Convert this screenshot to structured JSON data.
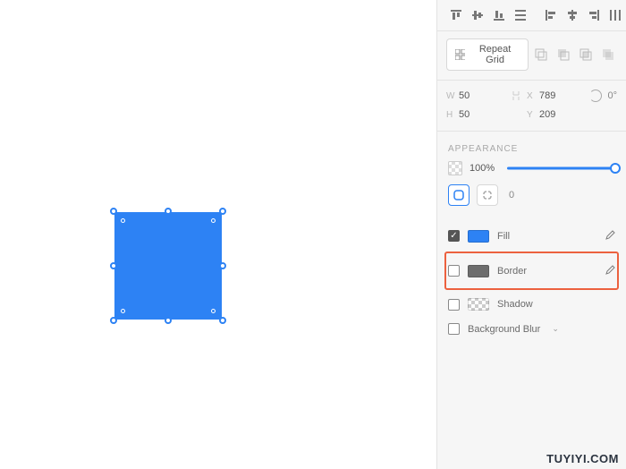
{
  "canvas": {
    "shape_color": "#2d82f4"
  },
  "repeat": {
    "label": "Repeat Grid"
  },
  "geom": {
    "w_label": "W",
    "w": "50",
    "h_label": "H",
    "h": "50",
    "x_label": "X",
    "x": "789",
    "y_label": "Y",
    "y": "209",
    "rotate": "0°"
  },
  "appearance": {
    "title": "APPEARANCE",
    "opacity": "100%",
    "radius": "0",
    "fill_label": "Fill",
    "border_label": "Border",
    "shadow_label": "Shadow",
    "blur_label": "Background Blur"
  },
  "watermark": "TUYIYI.COM"
}
